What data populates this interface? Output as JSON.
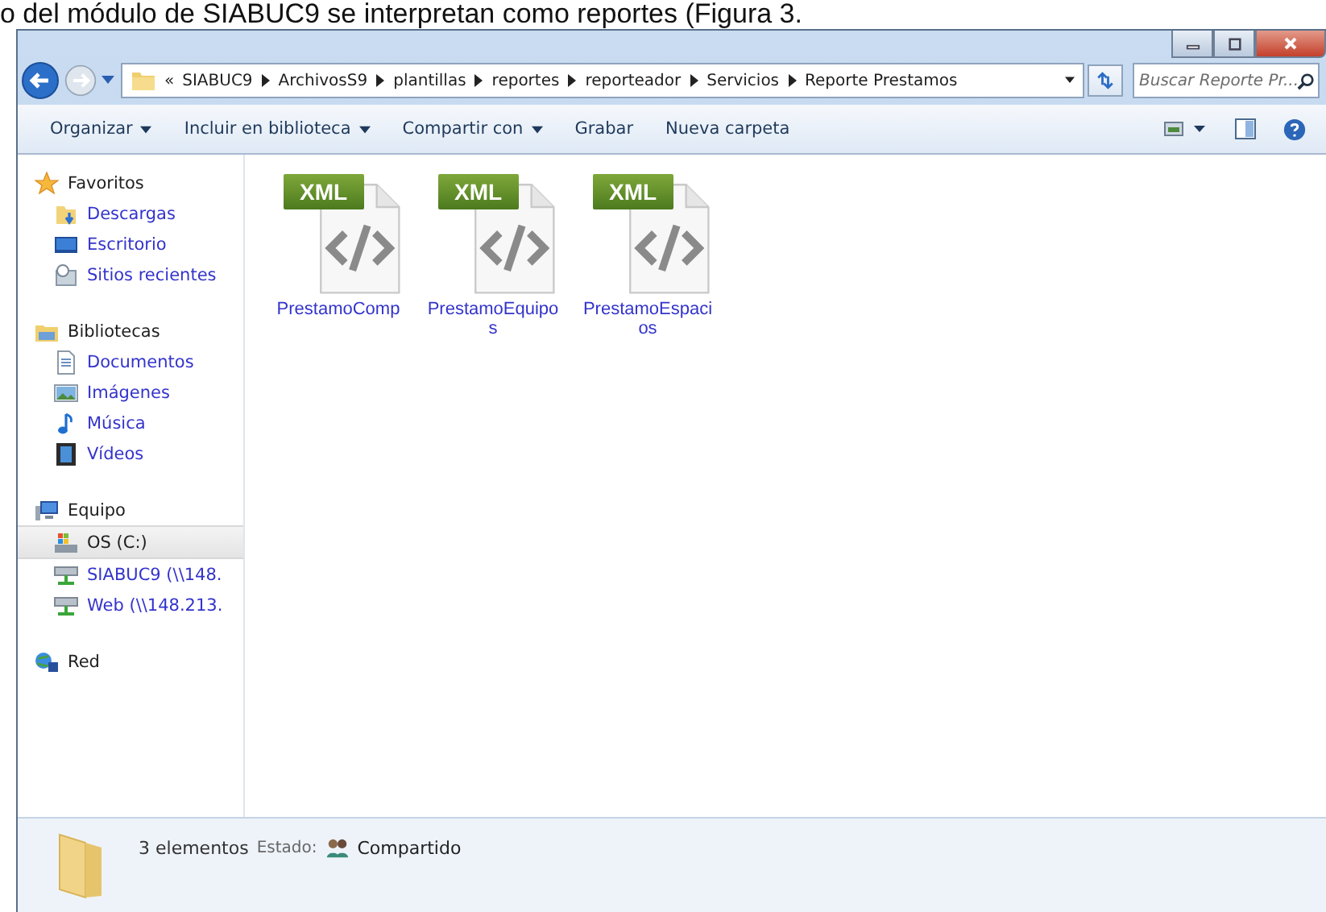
{
  "document_text": "o del módulo de SIABUC9 se interpretan como reportes (Figura 3.",
  "address_bar": {
    "overflow": "«",
    "crumbs": [
      "SIABUC9",
      "ArchivosS9",
      "plantillas",
      "reportes",
      "reporteador",
      "Servicios",
      "Reporte Prestamos"
    ]
  },
  "search": {
    "placeholder": "Buscar Reporte Pr..."
  },
  "toolbar": [
    {
      "label": "Organizar",
      "has_menu": true
    },
    {
      "label": "Incluir en biblioteca",
      "has_menu": true
    },
    {
      "label": "Compartir con",
      "has_menu": true
    },
    {
      "label": "Grabar",
      "has_menu": false
    },
    {
      "label": "Nueva carpeta",
      "has_menu": false
    }
  ],
  "sidebar": [
    {
      "label": "Favoritos",
      "kind": "star",
      "selected": false,
      "children": [
        {
          "label": "Descargas",
          "kind": "downloads",
          "selected": false
        },
        {
          "label": "Escritorio",
          "kind": "desktop",
          "selected": false
        },
        {
          "label": "Sitios recientes",
          "kind": "recent",
          "selected": false
        }
      ]
    },
    {
      "label": "Bibliotecas",
      "kind": "library",
      "selected": false,
      "children": [
        {
          "label": "Documentos",
          "kind": "document",
          "selected": false
        },
        {
          "label": "Imágenes",
          "kind": "image",
          "selected": false
        },
        {
          "label": "Música",
          "kind": "music",
          "selected": false
        },
        {
          "label": "Vídeos",
          "kind": "video",
          "selected": false
        }
      ]
    },
    {
      "label": "Equipo",
      "kind": "computer",
      "selected": false,
      "children": [
        {
          "label": "OS (C:)",
          "kind": "drive",
          "selected": true
        },
        {
          "label": "SIABUC9 (\\\\148.",
          "kind": "netdrive",
          "selected": false
        },
        {
          "label": "Web (\\\\148.213.",
          "kind": "netdrive",
          "selected": false
        }
      ]
    },
    {
      "label": "Red",
      "kind": "network",
      "selected": false
    }
  ],
  "files": [
    {
      "name": "PrestamoComp",
      "badge": "XML"
    },
    {
      "name": "PrestamoEquipos",
      "badge": "XML"
    },
    {
      "name": "PrestamoEspacios",
      "badge": "XML"
    }
  ],
  "status_bar": {
    "count": "3 elementos",
    "state_label": "Estado:",
    "state_value": "Compartido"
  }
}
